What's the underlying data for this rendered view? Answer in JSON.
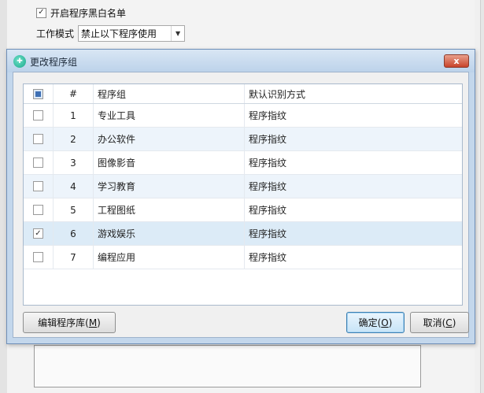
{
  "background": {
    "enable_list_checkbox": {
      "checked": true,
      "label": "开启程序黑白名单"
    },
    "work_mode": {
      "label": "工作模式",
      "value": "禁止以下程序使用"
    }
  },
  "dialog": {
    "title": "更改程序组",
    "close_glyph": "x",
    "table": {
      "headers": {
        "num": "#",
        "group": "程序组",
        "mode": "默认识别方式"
      },
      "rows": [
        {
          "num": "1",
          "group": "专业工具",
          "mode": "程序指纹",
          "checked": false
        },
        {
          "num": "2",
          "group": "办公软件",
          "mode": "程序指纹",
          "checked": false
        },
        {
          "num": "3",
          "group": "图像影音",
          "mode": "程序指纹",
          "checked": false
        },
        {
          "num": "4",
          "group": "学习教育",
          "mode": "程序指纹",
          "checked": false
        },
        {
          "num": "5",
          "group": "工程图纸",
          "mode": "程序指纹",
          "checked": false
        },
        {
          "num": "6",
          "group": "游戏娱乐",
          "mode": "程序指纹",
          "checked": true
        },
        {
          "num": "7",
          "group": "编程应用",
          "mode": "程序指纹",
          "checked": false
        }
      ]
    },
    "buttons": {
      "edit_library": {
        "text": "编辑程序库(",
        "mnemonic": "M",
        "tail": ")"
      },
      "ok": {
        "text": "确定(",
        "mnemonic": "O",
        "tail": ")"
      },
      "cancel": {
        "text": "取消(",
        "mnemonic": "C",
        "tail": ")"
      }
    }
  }
}
